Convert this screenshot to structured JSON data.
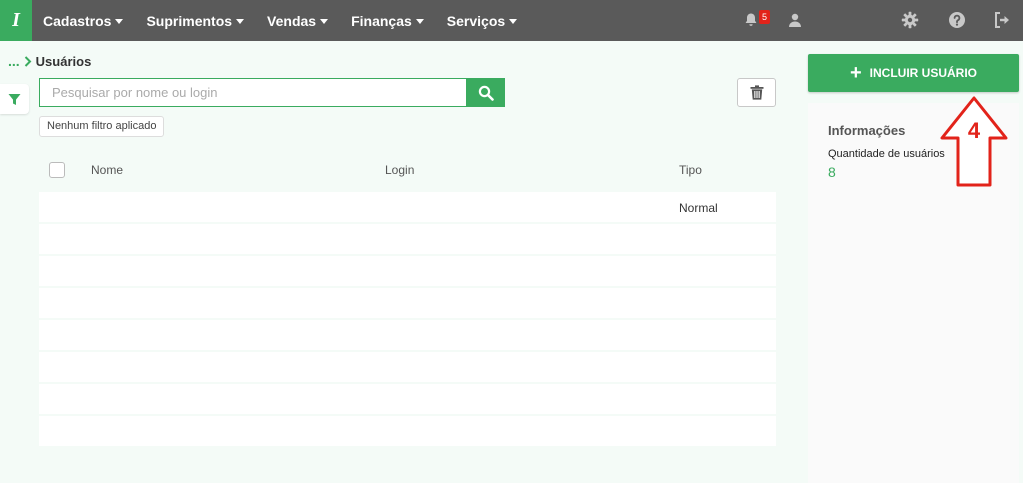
{
  "nav": {
    "logo": "I",
    "menus": [
      {
        "label": "Cadastros"
      },
      {
        "label": "Suprimentos"
      },
      {
        "label": "Vendas"
      },
      {
        "label": "Finanças"
      },
      {
        "label": "Serviços"
      }
    ],
    "notification_count": "5"
  },
  "breadcrumb": {
    "ellipsis": "...",
    "title": "Usuários"
  },
  "search": {
    "placeholder": "Pesquisar por nome ou login",
    "value": ""
  },
  "filter_chip": "Nenhum filtro aplicado",
  "table": {
    "columns": [
      "Nome",
      "Login",
      "Tipo"
    ],
    "rows": [
      {
        "nome": "",
        "login": "",
        "tipo": "Normal"
      },
      {
        "nome": "",
        "login": "",
        "tipo": ""
      },
      {
        "nome": "",
        "login": "",
        "tipo": ""
      },
      {
        "nome": "",
        "login": "",
        "tipo": ""
      },
      {
        "nome": "",
        "login": "",
        "tipo": ""
      },
      {
        "nome": "",
        "login": "",
        "tipo": ""
      },
      {
        "nome": "",
        "login": "",
        "tipo": ""
      },
      {
        "nome": "",
        "login": "",
        "tipo": ""
      }
    ]
  },
  "sidebar": {
    "include_button": "INCLUIR USUÁRIO",
    "info_title": "Informações",
    "user_count_label": "Quantidade de usuários",
    "user_count": "8"
  },
  "annotation": {
    "label": "4",
    "color": "#e2231a"
  },
  "colors": {
    "brand_green": "#3aab5f",
    "topbar": "#5a5a5a",
    "badge": "#e2231a"
  }
}
